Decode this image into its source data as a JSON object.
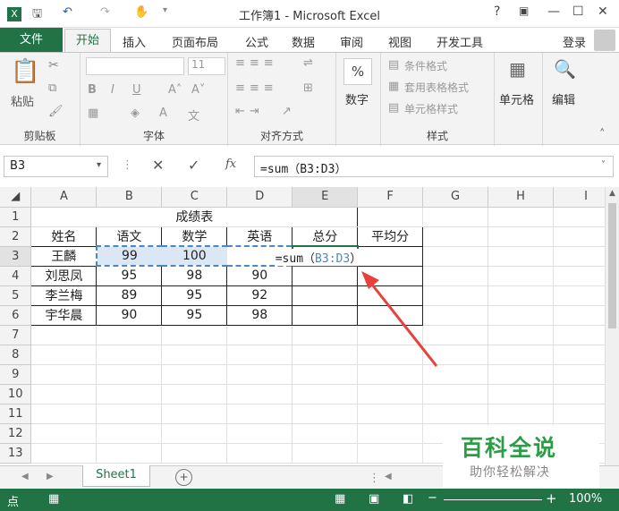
{
  "window": {
    "title": "工作簿1 - Microsoft Excel",
    "help": "?",
    "min": "—",
    "max": "☐",
    "close": "✕"
  },
  "tabs": {
    "file": "文件",
    "home": "开始",
    "insert": "插入",
    "layout": "页面布局",
    "formulas": "公式",
    "data": "数据",
    "review": "审阅",
    "view": "视图",
    "developer": "开发工具",
    "login": "登录"
  },
  "ribbon": {
    "clipboard": {
      "paste": "粘贴",
      "label": "剪贴板"
    },
    "font": {
      "size": "11",
      "bold": "B",
      "italic": "I",
      "underline": "U",
      "label": "字体"
    },
    "alignment": {
      "label": "对齐方式"
    },
    "number": {
      "percent": "%",
      "name": "数字"
    },
    "styles": {
      "cond": "条件格式",
      "table": "套用表格格式",
      "cell": "单元格样式",
      "label": "样式"
    },
    "cells": {
      "name": "单元格"
    },
    "editing": {
      "name": "编辑"
    }
  },
  "formula_bar": {
    "namebox": "B3",
    "cancel": "✕",
    "enter": "✓",
    "fx": "fx",
    "formula": "=sum（B3:D3）"
  },
  "columns": [
    "A",
    "B",
    "C",
    "D",
    "E",
    "F",
    "G",
    "H",
    "I"
  ],
  "rows": [
    "1",
    "2",
    "3",
    "4",
    "5",
    "6",
    "7",
    "8",
    "9",
    "10",
    "11",
    "12",
    "13"
  ],
  "table": {
    "title": "成绩表",
    "headers": [
      "姓名",
      "语文",
      "数学",
      "英语",
      "总分",
      "平均分"
    ],
    "records": [
      {
        "name": "王麟",
        "chinese": "99",
        "math": "100",
        "english": ""
      },
      {
        "name": "刘思凤",
        "chinese": "95",
        "math": "98",
        "english": "90"
      },
      {
        "name": "李兰梅",
        "chinese": "89",
        "math": "95",
        "english": "92"
      },
      {
        "name": "宇华晨",
        "chinese": "90",
        "math": "95",
        "english": "98"
      }
    ],
    "edit_prefix": "=sum（",
    "edit_ref": "B3:D3",
    "edit_suffix": "）"
  },
  "sheetbar": {
    "sheet1": "Sheet1",
    "add": "+"
  },
  "status": {
    "mode": "点",
    "zoom": "100%"
  },
  "watermark": {
    "brand": "百科全说",
    "slogan": "助你轻松解决"
  },
  "colors": {
    "accent": "#217346",
    "arrow": "#e8413c",
    "ref": "#4a86c8"
  }
}
